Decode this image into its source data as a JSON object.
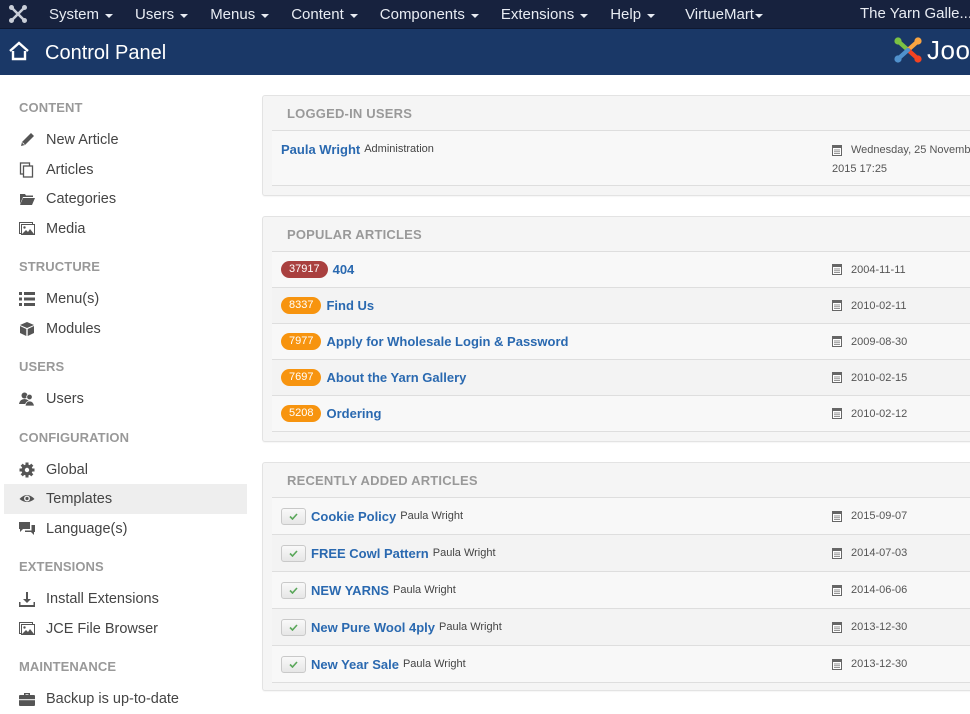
{
  "navbar": {
    "brand_icon": "joomla-icon",
    "menu": [
      {
        "label": "System",
        "caret": true
      },
      {
        "label": "Users",
        "caret": true
      },
      {
        "label": "Menus",
        "caret": true
      },
      {
        "label": "Content",
        "caret": true
      },
      {
        "label": "Components",
        "caret": true
      },
      {
        "label": "Extensions",
        "caret": true
      },
      {
        "label": "Help",
        "caret": true
      },
      {
        "label": "VirtueMart",
        "caret": true
      }
    ],
    "site_name": "The Yarn Galle..."
  },
  "header": {
    "icon": "home-icon",
    "title": "Control Panel",
    "logo_text": "Joo"
  },
  "sidebar": {
    "sections": [
      {
        "title": "CONTENT",
        "items": [
          {
            "label": "New Article",
            "icon": "pencil-icon"
          },
          {
            "label": "Articles",
            "icon": "copy-icon"
          },
          {
            "label": "Categories",
            "icon": "folder-icon"
          },
          {
            "label": "Media",
            "icon": "image-icon"
          }
        ]
      },
      {
        "title": "STRUCTURE",
        "items": [
          {
            "label": "Menu(s)",
            "icon": "list-icon"
          },
          {
            "label": "Modules",
            "icon": "cube-icon"
          }
        ]
      },
      {
        "title": "USERS",
        "items": [
          {
            "label": "Users",
            "icon": "users-icon"
          }
        ]
      },
      {
        "title": "CONFIGURATION",
        "items": [
          {
            "label": "Global",
            "icon": "gear-icon"
          },
          {
            "label": "Templates",
            "icon": "eye-icon",
            "active": true
          },
          {
            "label": "Language(s)",
            "icon": "comments-icon"
          }
        ]
      },
      {
        "title": "EXTENSIONS",
        "items": [
          {
            "label": "Install Extensions",
            "icon": "download-icon"
          },
          {
            "label": "JCE File Browser",
            "icon": "image-icon"
          }
        ]
      },
      {
        "title": "MAINTENANCE",
        "items": [
          {
            "label": "Backup is up-to-date",
            "icon": "briefcase-icon"
          }
        ]
      }
    ]
  },
  "logged_in_users": {
    "title": "LOGGED-IN USERS",
    "rows": [
      {
        "name": "Paula Wright",
        "client": "Administration",
        "date_line1": "Wednesday, 25 Novemb",
        "date_line2": "2015 17:25"
      }
    ]
  },
  "popular_articles": {
    "title": "POPULAR ARTICLES",
    "rows": [
      {
        "hits": "37917",
        "badge_color": "#a9403f",
        "title": "404",
        "date": "2004-11-11"
      },
      {
        "hits": "8337",
        "badge_color": "#f7940f",
        "title": "Find Us",
        "date": "2010-02-11"
      },
      {
        "hits": "7977",
        "badge_color": "#f7940f",
        "title": "Apply for Wholesale Login & Password",
        "date": "2009-08-30"
      },
      {
        "hits": "7697",
        "badge_color": "#f7940f",
        "title": "About the Yarn Gallery",
        "date": "2010-02-15"
      },
      {
        "hits": "5208",
        "badge_color": "#f7940f",
        "title": "Ordering",
        "date": "2010-02-12"
      }
    ]
  },
  "recent_articles": {
    "title": "RECENTLY ADDED ARTICLES",
    "rows": [
      {
        "status": "published",
        "title": "Cookie Policy",
        "author": "Paula Wright",
        "date": "2015-09-07"
      },
      {
        "status": "published",
        "title": "FREE Cowl Pattern",
        "author": "Paula Wright",
        "date": "2014-07-03"
      },
      {
        "status": "published",
        "title": "NEW YARNS",
        "author": "Paula Wright",
        "date": "2014-06-06"
      },
      {
        "status": "published",
        "title": "New Pure Wool 4ply",
        "author": "Paula Wright",
        "date": "2013-12-30"
      },
      {
        "status": "published",
        "title": "New Year Sale",
        "author": "Paula Wright",
        "date": "2013-12-30"
      }
    ]
  },
  "colors": {
    "navbar_bg": "#17223e",
    "header_bg": "#1a3867",
    "link": "#2a69b0",
    "badge_important": "#a9403f",
    "badge_warning": "#f7940f",
    "check_green": "#5aa75a"
  }
}
